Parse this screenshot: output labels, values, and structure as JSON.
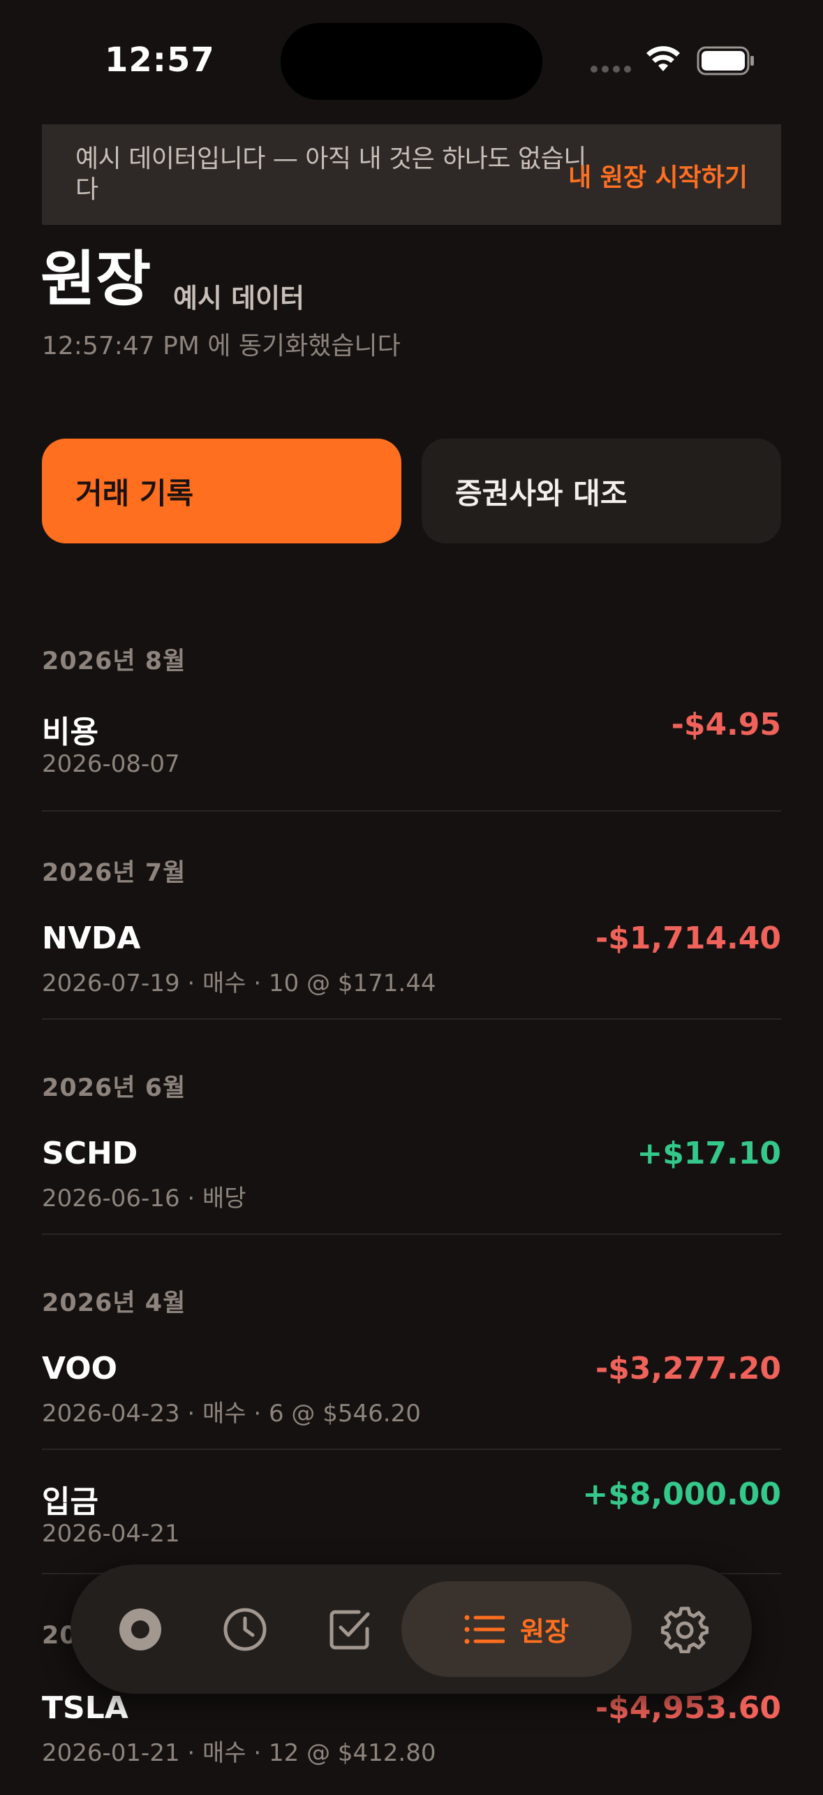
{
  "status_bar": {
    "time": "12:57"
  },
  "banner": {
    "text": "예시 데이터입니다 — 아직 내 것은 하나도 없습니다",
    "action_label": "내 원장 시작하기"
  },
  "header": {
    "title": "원장",
    "tag": "예시 데이터",
    "sync_text": "12:57:47 PM 에 동기화했습니다"
  },
  "actions": {
    "primary_label": "거래 기록",
    "secondary_label": "증권사와 대조"
  },
  "ledger": {
    "months": [
      {
        "label": "2026년 8월",
        "entries": [
          {
            "name": "비용",
            "detail": "2026-08-07",
            "amount": "-$4.95",
            "sign": "neg"
          }
        ]
      },
      {
        "label": "2026년 7월",
        "entries": [
          {
            "name": "NVDA",
            "detail": "2026-07-19 · 매수 · 10 @ $171.44",
            "amount": "-$1,714.40",
            "sign": "neg"
          }
        ]
      },
      {
        "label": "2026년 6월",
        "entries": [
          {
            "name": "SCHD",
            "detail": "2026-06-16 · 배당",
            "amount": "+$17.10",
            "sign": "pos"
          }
        ]
      },
      {
        "label": "2026년 4월",
        "entries": [
          {
            "name": "VOO",
            "detail": "2026-04-23 · 매수 · 6 @ $546.20",
            "amount": "-$3,277.20",
            "sign": "neg"
          },
          {
            "name": "입금",
            "detail": "2026-04-21",
            "amount": "+$8,000.00",
            "sign": "pos"
          }
        ]
      },
      {
        "label": "20",
        "entries": [
          {
            "name": "TSLA",
            "detail": "2026-01-21 · 매수 · 12 @ $412.80",
            "amount": "-$4,953.60",
            "sign": "neg"
          }
        ]
      }
    ]
  },
  "tabbar": {
    "active_label": "원장",
    "icons": [
      "overview-icon",
      "history-icon",
      "checklist-icon",
      "ledger-list-icon",
      "gear-icon"
    ]
  },
  "colors": {
    "accent": "#ff6f1f",
    "negative": "#f0625a",
    "positive": "#34c88a",
    "background": "#141110"
  }
}
